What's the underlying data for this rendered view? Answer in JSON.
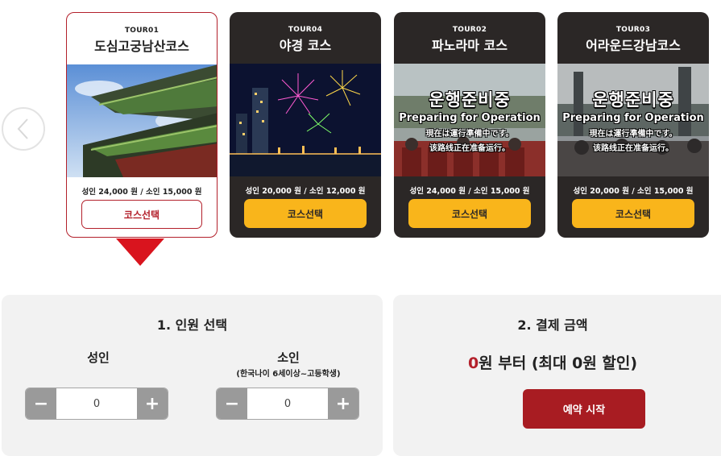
{
  "cards": [
    {
      "code": "TOUR01",
      "title": "도심고궁남산코스",
      "price": "성인 24,000 원 / 소인 15,000 원",
      "button": "코스선택"
    },
    {
      "code": "TOUR04",
      "title": "야경 코스",
      "price": "성인 20,000 원 / 소인 12,000 원",
      "button": "코스선택"
    },
    {
      "code": "TOUR02",
      "title": "파노라마 코스",
      "price": "성인 24,000 원 / 소인 15,000 원",
      "button": "코스선택",
      "overlay": {
        "ko": "운행준비중",
        "en": "Preparing for Operation",
        "jp": "現在は運行準備中です。",
        "cn": "该路线正在准备运行。"
      }
    },
    {
      "code": "TOUR03",
      "title": "어라운드강남코스",
      "price": "성인 20,000 원 / 소인 15,000 원",
      "button": "코스선택",
      "overlay": {
        "ko": "운행준비중",
        "en": "Preparing for Operation",
        "jp": "現在は運行準備中です。",
        "cn": "该路线正在准备运行。"
      }
    }
  ],
  "people": {
    "title": "1. 인원 선택",
    "adult": {
      "label": "성인",
      "value": "0",
      "minus": "−",
      "plus": "+"
    },
    "child": {
      "label": "소인",
      "sub": "(한국나이 6세이상~고등학생)",
      "value": "0",
      "minus": "−",
      "plus": "+"
    }
  },
  "payment": {
    "title": "2. 결제 금액",
    "amount": "0",
    "amount_suffix": "원 부터 (최대 0원 할인)",
    "book_button": "예약 시작"
  },
  "colors": {
    "accent": "#b3202b",
    "yellow": "#f9b51b",
    "dark": "#2b2726",
    "panel": "#f2f2f2"
  }
}
